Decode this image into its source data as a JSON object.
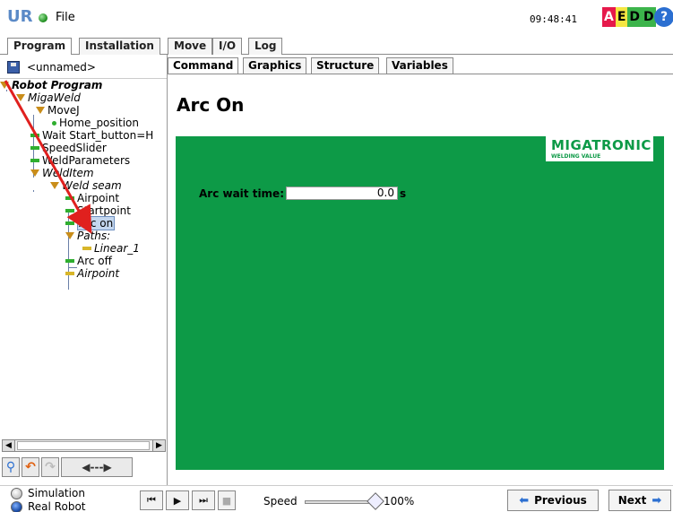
{
  "topbar": {
    "logo": "UR",
    "menu_file": "File",
    "clock": "09:48:41",
    "aedd": [
      "A",
      "E",
      "D",
      "D"
    ],
    "help": "?"
  },
  "main_tabs": [
    "Program",
    "Installation",
    "Move",
    "I/O",
    "Log"
  ],
  "program": {
    "name": "<unnamed>"
  },
  "sub_tabs": [
    "Command",
    "Graphics",
    "Structure",
    "Variables"
  ],
  "tree": [
    {
      "label": "Robot Program",
      "style": "bold-italic",
      "icon": "triangle"
    },
    {
      "label": "MigaWeld",
      "style": "italic",
      "icon": "triangle"
    },
    {
      "label": "MoveJ",
      "style": "normal",
      "icon": "triangle"
    },
    {
      "label": "Home_position",
      "style": "normal",
      "icon": "dot"
    },
    {
      "label": "Wait Start_button=H",
      "style": "normal",
      "icon": "bar-green"
    },
    {
      "label": "SpeedSlider",
      "style": "normal",
      "icon": "bar-green"
    },
    {
      "label": "WeldParameters",
      "style": "normal",
      "icon": "bar-green"
    },
    {
      "label": "WeldItem",
      "style": "italic",
      "icon": "triangle"
    },
    {
      "label": "Weld seam",
      "style": "italic",
      "icon": "triangle"
    },
    {
      "label": "Airpoint",
      "style": "normal",
      "icon": "bar-green"
    },
    {
      "label": "Startpoint",
      "style": "normal",
      "icon": "bar-green"
    },
    {
      "label": "Arc on",
      "style": "normal",
      "icon": "bar-green",
      "selected": true
    },
    {
      "label": "Paths:",
      "style": "italic",
      "icon": "triangle"
    },
    {
      "label": "Linear_1",
      "style": "italic",
      "icon": "bar-yellow"
    },
    {
      "label": "Arc off",
      "style": "normal",
      "icon": "bar-green"
    },
    {
      "label": "Airpoint",
      "style": "italic",
      "icon": "bar-yellow"
    }
  ],
  "content": {
    "title": "Arc On",
    "brand_name": "MIGATRONIC",
    "brand_sub": "WELDING VALUE",
    "arc_wait_label": "Arc wait time:",
    "arc_wait_value": "0.0",
    "arc_wait_unit": "s"
  },
  "bottombar": {
    "simulation": "Simulation",
    "real_robot": "Real Robot",
    "speed_label": "Speed",
    "speed_value": "100%",
    "speed_fraction": 1.0,
    "previous": "Previous",
    "next": "Next"
  },
  "colors": {
    "panel_green": "#0d9a47",
    "annotation_red": "#e0201e",
    "accent_blue": "#2b6fd1"
  }
}
